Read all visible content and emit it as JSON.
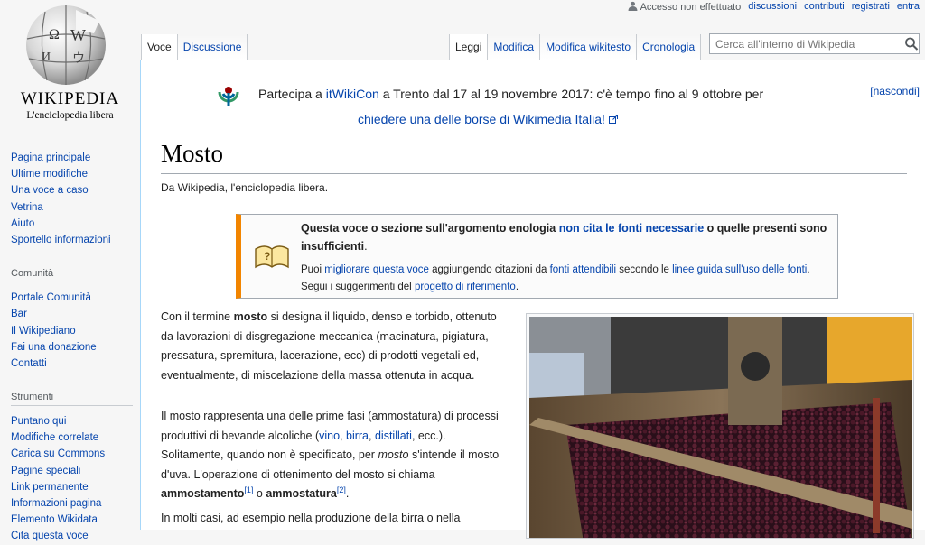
{
  "personal": {
    "not_logged": "Accesso non effettuato",
    "talk": "discussioni",
    "contributions": "contributi",
    "register": "registrati",
    "login": "entra"
  },
  "logo": {
    "wordmark": "WIKIPEDIA",
    "tagline": "L'enciclopedia libera"
  },
  "sidebar": {
    "nav": [
      "Pagina principale",
      "Ultime modifiche",
      "Una voce a caso",
      "Vetrina",
      "Aiuto",
      "Sportello informazioni"
    ],
    "community_heading": "Comunità",
    "community": [
      "Portale Comunità",
      "Bar",
      "Il Wikipediano",
      "Fai una donazione",
      "Contatti"
    ],
    "tools_heading": "Strumenti",
    "tools": [
      "Puntano qui",
      "Modifiche correlate",
      "Carica su Commons",
      "Pagine speciali",
      "Link permanente",
      "Informazioni pagina",
      "Elemento Wikidata",
      "Cita questa voce"
    ]
  },
  "tabs": {
    "left": [
      "Voce",
      "Discussione"
    ],
    "right": [
      "Leggi",
      "Modifica",
      "Modifica wikitesto",
      "Cronologia"
    ]
  },
  "search": {
    "placeholder": "Cerca all'interno di Wikipedia"
  },
  "notice": {
    "pre": "Partecipa a ",
    "link1": "itWikiCon",
    "mid": " a Trento dal 17 al 19 novembre 2017: c'è tempo fino al 9 ottobre per",
    "link2": "chiedere una delle borse di Wikimedia Italia!",
    "dismiss": "[nascondi]"
  },
  "page": {
    "title": "Mosto",
    "subtitle": "Da Wikipedia, l'enciclopedia libera."
  },
  "ambox": {
    "t1": "Questa voce o sezione sull'argomento enologia ",
    "t1_link": "non cita le fonti necessarie",
    "t2": " o quelle presenti sono insufficienti",
    "t3": ".",
    "b1": "Puoi ",
    "b1_link": "migliorare questa voce",
    "b2": " aggiungendo citazioni da ",
    "b2_link": "fonti attendibili",
    "b3": " secondo le ",
    "b3_link": "linee guida sull'uso delle fonti",
    "b4": ". Segui i suggerimenti del ",
    "b4_link": "progetto di riferimento",
    "b5": "."
  },
  "body": {
    "p1a": "Con il termine ",
    "p1b": "mosto",
    "p1c": " si designa il liquido, denso e torbido, ottenuto da lavorazioni di disgregazione meccanica (macinatura, pigiatura, pressatura, spremitura, lacerazione, ecc) di prodotti vegetali ed, eventualmente, di miscelazione della massa ottenuta in acqua.",
    "p2a": "Il mosto rappresenta una delle prime fasi (ammostatura) di processi produttivi di bevande alcoliche (",
    "p2_l1": "vino",
    "p2_l2": "birra",
    "p2_l3": "distillati",
    "p2b": ", ecc.). Solitamente, quando non è specificato, per ",
    "p2c": "mosto",
    "p2d": " s'intende il mosto d'uva. L'operazione di ottenimento del mosto si chiama ",
    "p2e": "ammostamento",
    "p2_ref1": "[1]",
    "p2f": " o ",
    "p2g": "ammostatura",
    "p2_ref2": "[2]",
    "p2h": ".",
    "p3": "In molti casi, ad esempio nella produzione della birra o nella"
  }
}
